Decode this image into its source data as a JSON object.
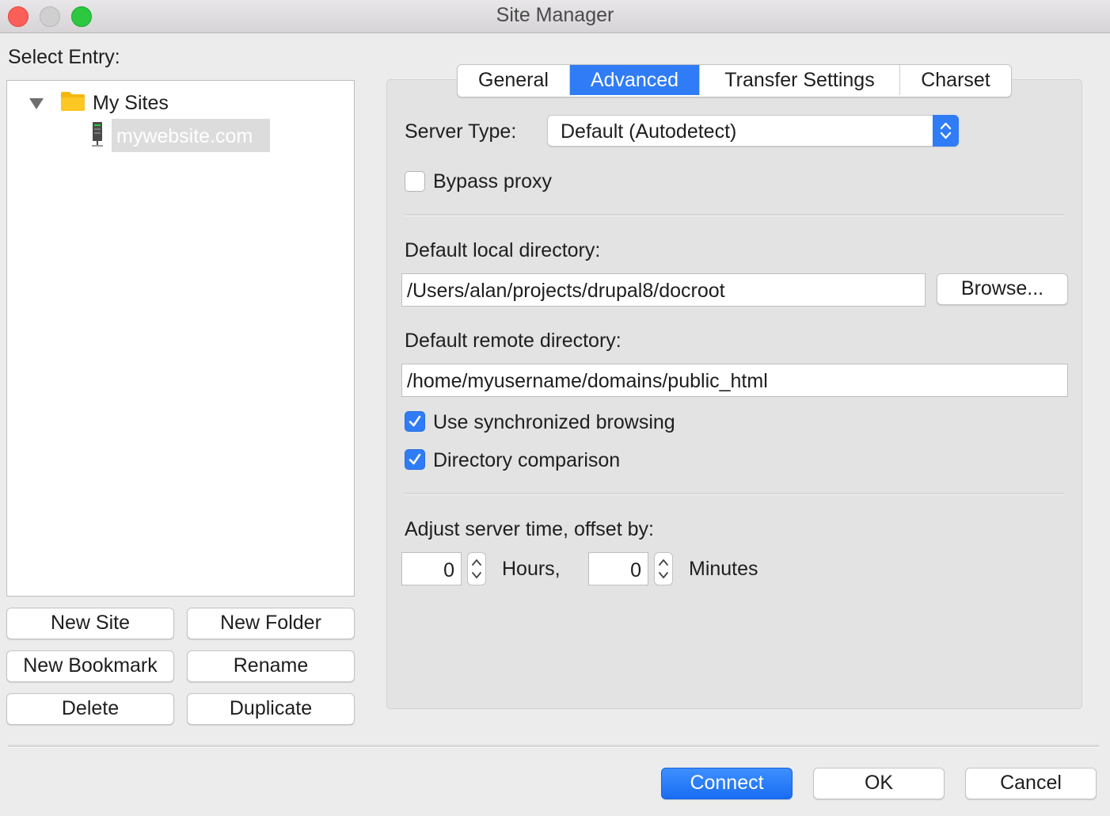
{
  "window": {
    "title": "Site Manager"
  },
  "left": {
    "select_entry_label": "Select Entry:",
    "tree": {
      "root_label": "My Sites",
      "items": [
        {
          "label": "mywebsite.com"
        }
      ]
    },
    "buttons": {
      "new_site": "New Site",
      "new_folder": "New Folder",
      "new_bookmark": "New Bookmark",
      "rename": "Rename",
      "delete": "Delete",
      "duplicate": "Duplicate"
    }
  },
  "tabs": [
    {
      "label": "General",
      "active": false
    },
    {
      "label": "Advanced",
      "active": true
    },
    {
      "label": "Transfer Settings",
      "active": false
    },
    {
      "label": "Charset",
      "active": false
    }
  ],
  "advanced": {
    "server_type_label": "Server Type:",
    "server_type_value": "Default (Autodetect)",
    "bypass_proxy_label": "Bypass proxy",
    "bypass_proxy_checked": false,
    "local_dir_label": "Default local directory:",
    "local_dir_value": "/Users/alan/projects/drupal8/docroot",
    "browse_label": "Browse...",
    "remote_dir_label": "Default remote directory:",
    "remote_dir_value": "/home/myusername/domains/public_html",
    "sync_browsing_label": "Use synchronized browsing",
    "sync_browsing_checked": true,
    "dir_comparison_label": "Directory comparison",
    "dir_comparison_checked": true,
    "adjust_time_label": "Adjust server time, offset by:",
    "hours_value": "0",
    "hours_label": "Hours,",
    "minutes_value": "0",
    "minutes_label": "Minutes"
  },
  "footer": {
    "connect": "Connect",
    "ok": "OK",
    "cancel": "Cancel"
  },
  "colors": {
    "accent": "#2f7cf6",
    "folder": "#f5b70e"
  }
}
